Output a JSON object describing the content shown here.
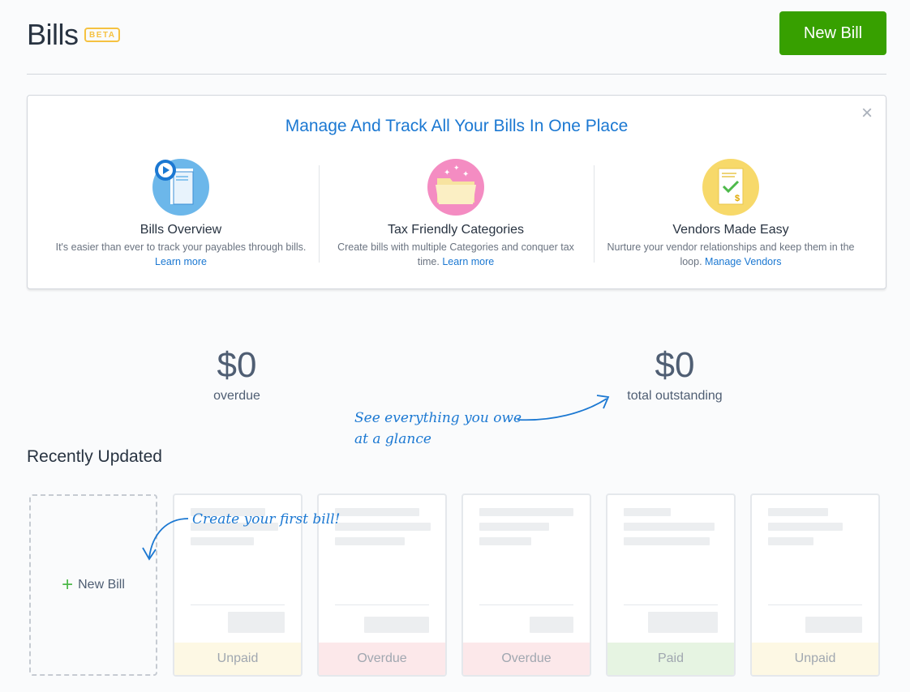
{
  "header": {
    "title": "Bills",
    "beta": "BETA",
    "new_bill_label": "New Bill"
  },
  "promo": {
    "title": "Manage And Track All Your Bills In One Place",
    "close": "×",
    "columns": [
      {
        "icon": "document-play-icon",
        "heading": "Bills Overview",
        "text": "It's easier than ever to track your payables through bills.",
        "link": "Learn more"
      },
      {
        "icon": "folder-sparkle-icon",
        "heading": "Tax Friendly Categories",
        "text": "Create bills with multiple Categories and conquer tax time.",
        "link": "Learn more"
      },
      {
        "icon": "invoice-check-icon",
        "heading": "Vendors Made Easy",
        "text": "Nurture your vendor relationships and keep them in the loop.",
        "link": "Manage Vendors"
      }
    ]
  },
  "stats": {
    "overdue_amount": "$0",
    "overdue_label": "overdue",
    "outstanding_amount": "$0",
    "outstanding_label": "total outstanding"
  },
  "notes": {
    "glance_line1": "See everything you owe",
    "glance_line2": "at a glance",
    "first_bill": "Create your first bill!"
  },
  "recent": {
    "title": "Recently Updated",
    "new_card_plus": "+",
    "new_card_label": "New Bill",
    "cards": [
      {
        "status": "Unpaid",
        "color": "#fdf8e4"
      },
      {
        "status": "Overdue",
        "color": "#fce8ea"
      },
      {
        "status": "Overdue",
        "color": "#fce8ea"
      },
      {
        "status": "Paid",
        "color": "#e6f4e2"
      },
      {
        "status": "Unpaid",
        "color": "#fdf8e4"
      }
    ]
  },
  "colors": {
    "brand_green": "#37a000",
    "link_blue": "#1b78d2",
    "beta_yellow": "#f5c241"
  }
}
